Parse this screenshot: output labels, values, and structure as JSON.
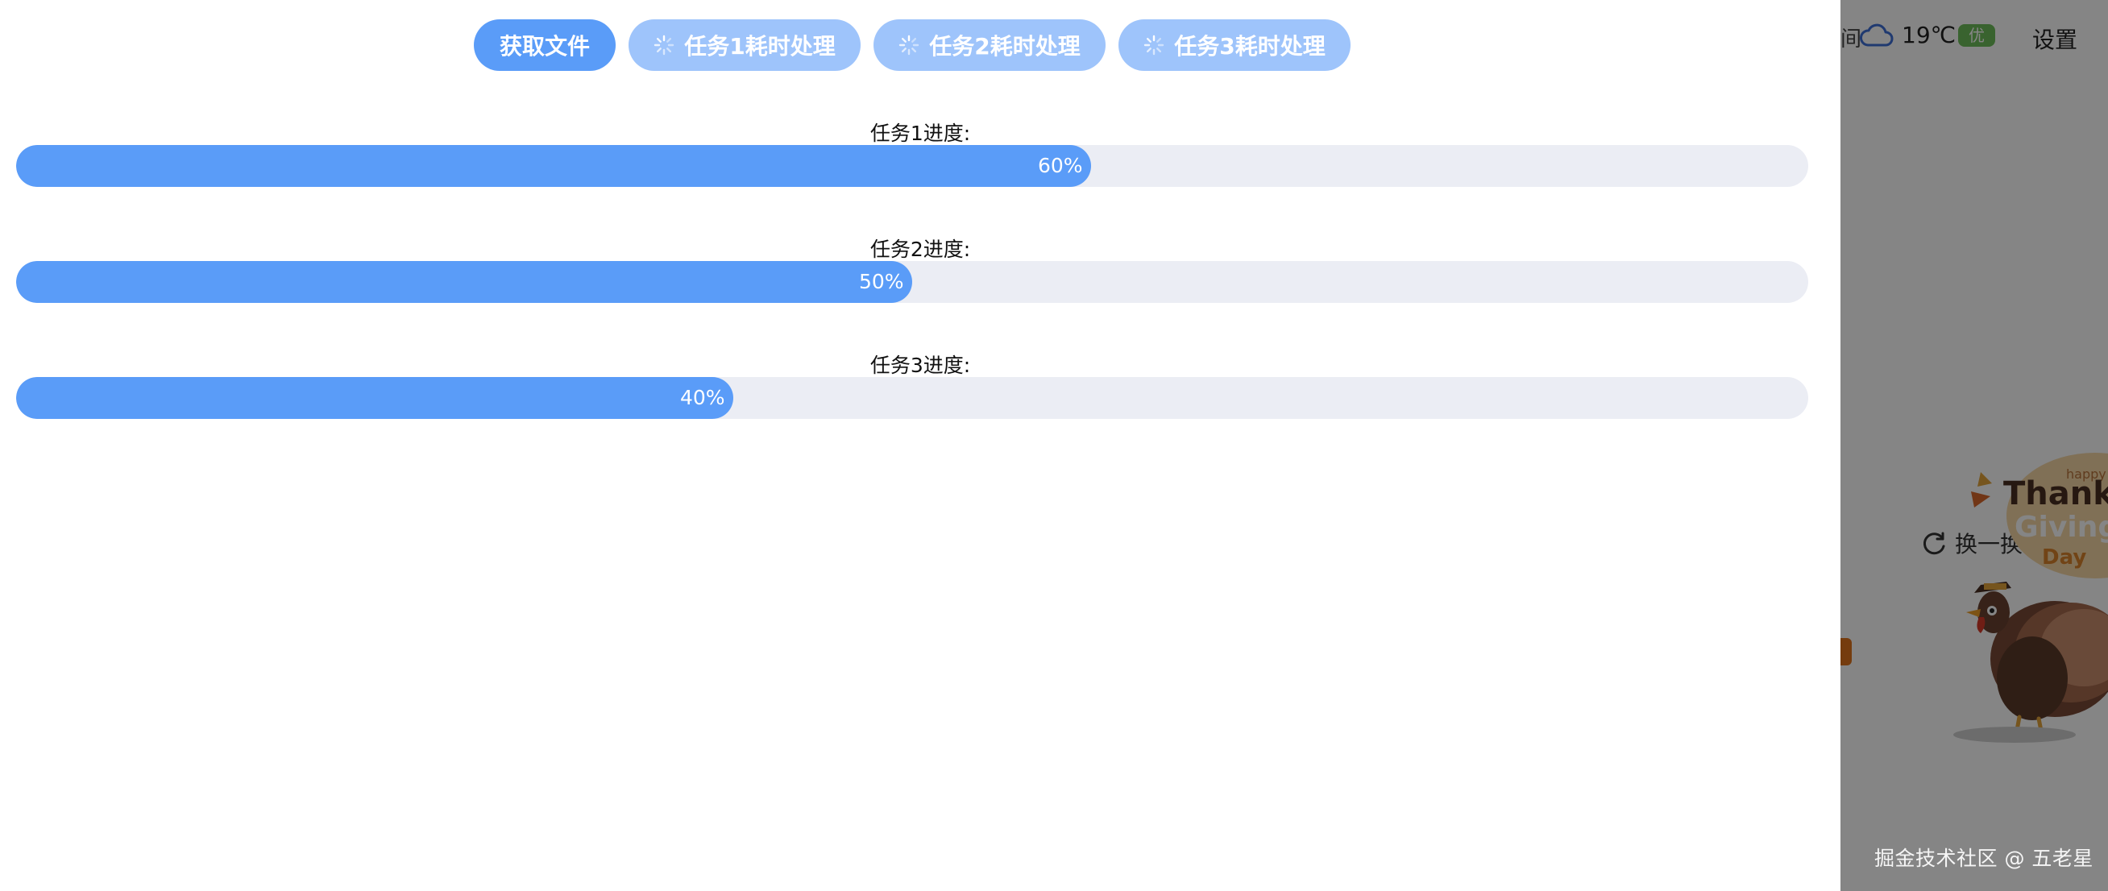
{
  "toolbar": {
    "fetch_label": "获取文件",
    "task1_label": "任务1耗时处理",
    "task2_label": "任务2耗时处理",
    "task3_label": "任务3耗时处理"
  },
  "tasks": [
    {
      "label": "任务1进度:",
      "progress": 60,
      "progress_text": "60%"
    },
    {
      "label": "任务2进度:",
      "progress": 50,
      "progress_text": "50%"
    },
    {
      "label": "任务3进度:",
      "progress": 40,
      "progress_text": "40%"
    }
  ],
  "background_page": {
    "edge_char": "间",
    "temperature": "19℃",
    "air_quality": "优",
    "settings_label": "设置",
    "refresh_label": "换一换",
    "illustration_text": [
      "happy",
      "Thanks",
      "Giving",
      "Day"
    ]
  },
  "credit": "掘金技术社区 @ 五老星",
  "colors": {
    "primary": "#5a9cf8",
    "loading_button": "#9ec4fb",
    "bar_track": "#ebedf4",
    "overlay": "rgba(0,0,0,0.48)",
    "aqi_badge": "#6dbf5a"
  },
  "icons": {
    "loading": "spinner-icon",
    "weather": "cloud-icon",
    "refresh": "refresh-icon"
  }
}
